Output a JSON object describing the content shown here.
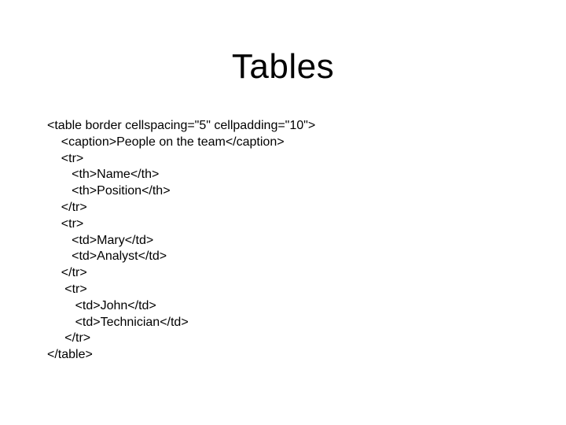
{
  "title": "Tables",
  "code": "<table border cellspacing=\"5\" cellpadding=\"10\">\n    <caption>People on the team</caption>\n    <tr>\n       <th>Name</th>\n       <th>Position</th>\n    </tr>\n    <tr>\n       <td>Mary</td>\n       <td>Analyst</td>\n    </tr>\n     <tr>\n        <td>John</td>\n        <td>Technician</td>\n     </tr>\n</table>"
}
